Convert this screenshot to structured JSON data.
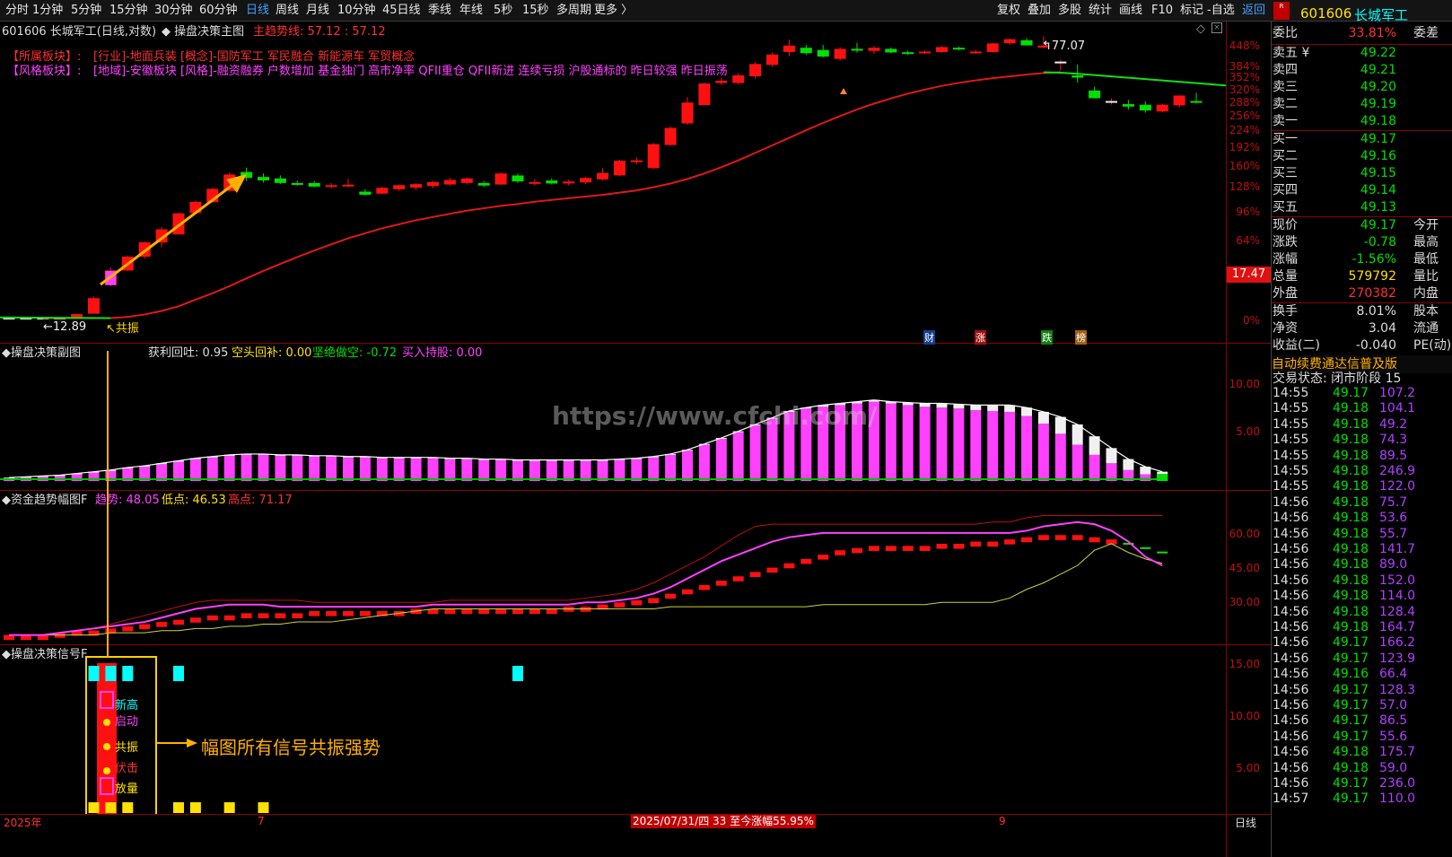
{
  "toolbar": {
    "periods": [
      "分时",
      "1分钟",
      "5分钟",
      "15分钟",
      "30分钟",
      "60分钟",
      "日线",
      "周线",
      "月线",
      "10分钟",
      "45日线",
      "季线",
      "年线",
      "5秒",
      "15秒",
      "多周期",
      "更多 〉"
    ],
    "active": "日线",
    "right": [
      "复权",
      "叠加",
      "多股",
      "统计",
      "画线",
      "F10",
      "标记",
      "-自选",
      "返回"
    ]
  },
  "main": {
    "title": "601606 长城军工(日线,对数)",
    "indicator_name": "操盘决策主图",
    "trend_label": "主趋势线: 57.12 : 57.12",
    "sector_label": "【所属板块】:",
    "sector_text": "[行业]-地面兵装 [概念]-国防军工 军民融合 新能源车 军贸概念",
    "style_label": "【风格板块】:",
    "style_text": "[地域]-安徽板块 [风格]-融资融券 户数增加 基金独门 高市净率 QFII重仓 QFII新进 连续亏损 沪股通标的 昨日较强 昨日振荡",
    "high_label": "77.07",
    "low_label": "12.89",
    "resonance_label": "共振",
    "current_price_tag": "17.47",
    "pct_ticks": [
      "448%",
      "384%",
      "352%",
      "320%",
      "288%",
      "256%",
      "224%",
      "192%",
      "160%",
      "128%",
      "96%",
      "64%",
      "0%"
    ],
    "event_tags": [
      "财",
      "涨",
      "跌",
      "榜"
    ]
  },
  "sub1": {
    "name": "操盘决策副图",
    "v1": "获利回吐: 0.95",
    "v2": "空头回补: 0.00",
    "v3": "坚绝做空: -0.72",
    "v4": "买入持股: 0.00",
    "ticks": [
      "10.00",
      "5.00"
    ],
    "watermark": "https://www.cfchi.com/",
    "values": [
      0.3,
      0.4,
      0.5,
      0.6,
      0.8,
      1.0,
      1.2,
      1.5,
      1.7,
      2.0,
      2.3,
      2.6,
      2.8,
      3.0,
      3.1,
      3.1,
      3.0,
      3.0,
      2.9,
      2.9,
      2.8,
      2.8,
      2.7,
      2.7,
      2.7,
      2.7,
      2.6,
      2.6,
      2.5,
      2.5,
      2.4,
      2.4,
      2.4,
      2.4,
      2.4,
      2.4,
      2.5,
      2.6,
      2.8,
      3.1,
      3.6,
      4.3,
      5.0,
      5.8,
      6.6,
      7.4,
      8.2,
      8.6,
      8.8,
      9.0,
      9.2,
      9.4,
      9.2,
      9.0,
      8.8,
      8.7,
      8.6,
      8.4,
      8.3,
      8.2,
      7.7,
      6.8,
      5.6,
      4.3,
      3.1,
      2.1,
      1.3,
      0.8,
      0.5
    ],
    "white_caps": [
      0.1,
      0.1,
      0.1,
      0.1,
      0.1,
      0.1,
      0.1,
      0.1,
      0.1,
      0.1,
      0.1,
      0.1,
      0.1,
      0.1,
      0.1,
      0.1,
      0.1,
      0.1,
      0.1,
      0.1,
      0.1,
      0.1,
      0.1,
      0.1,
      0.1,
      0.1,
      0.1,
      0.1,
      0.1,
      0.1,
      0.1,
      0.1,
      0.1,
      0.1,
      0.1,
      0.1,
      0.1,
      0.1,
      0.1,
      0.1,
      0.1,
      0.1,
      0.1,
      0.1,
      0.1,
      0.1,
      0.1,
      0.1,
      0.2,
      0.2,
      0.2,
      0.2,
      0.2,
      0.3,
      0.4,
      0.5,
      0.5,
      0.6,
      0.7,
      0.8,
      1.0,
      1.4,
      2.0,
      2.4,
      2.2,
      1.8,
      1.3,
      0.9,
      0.6
    ]
  },
  "sub2": {
    "name": "资金趋势幅图F",
    "v1": "趋势: 48.05",
    "v2": "低点: 46.53",
    "v3": "高点: 71.17",
    "ticks": [
      "60.00",
      "45.00",
      "30.00"
    ],
    "bars": [
      16,
      16,
      16,
      17,
      18,
      18,
      19,
      20,
      21,
      22,
      23,
      24,
      25,
      25,
      26,
      26,
      26,
      26,
      27,
      27,
      27,
      27,
      27,
      27,
      28,
      28,
      28,
      28,
      28,
      28,
      28,
      28,
      28,
      29,
      29,
      30,
      31,
      32,
      33,
      35,
      37,
      39,
      41,
      43,
      45,
      47,
      49,
      51,
      53,
      55,
      56,
      57,
      57,
      57,
      57,
      58,
      58,
      59,
      59,
      60,
      61,
      62,
      62,
      62,
      61,
      60,
      58,
      56,
      54
    ],
    "trend": [
      16,
      16,
      16,
      17,
      18,
      19,
      20,
      21,
      22,
      24,
      26,
      28,
      29,
      30,
      30,
      30,
      29,
      29,
      29,
      29,
      29,
      29,
      29,
      29,
      29,
      30,
      30,
      30,
      30,
      30,
      30,
      30,
      30,
      30,
      31,
      31,
      32,
      33,
      35,
      38,
      42,
      46,
      50,
      53,
      56,
      59,
      61,
      62,
      63,
      63,
      63,
      63,
      63,
      63,
      63,
      63,
      63,
      63,
      63,
      63,
      64,
      66,
      67,
      68,
      67,
      64,
      59,
      52,
      48
    ],
    "high": [
      16,
      16,
      16,
      17,
      18,
      19,
      21,
      23,
      25,
      27,
      29,
      31,
      32,
      32,
      32,
      32,
      32,
      32,
      31,
      31,
      31,
      31,
      31,
      31,
      31,
      31,
      32,
      32,
      32,
      32,
      32,
      32,
      32,
      32,
      33,
      34,
      35,
      37,
      40,
      44,
      48,
      52,
      57,
      62,
      66,
      67,
      67,
      67,
      67,
      67,
      67,
      67,
      67,
      67,
      67,
      67,
      67,
      67,
      68,
      68,
      70,
      71,
      71,
      71,
      71,
      71,
      71,
      71,
      71
    ],
    "low": [
      16,
      16,
      16,
      16,
      16,
      16,
      17,
      17,
      17,
      18,
      18,
      19,
      19,
      20,
      20,
      21,
      21,
      22,
      22,
      22,
      23,
      24,
      25,
      26,
      27,
      28,
      28,
      28,
      28,
      28,
      28,
      28,
      28,
      28,
      28,
      28,
      28,
      28,
      28,
      29,
      29,
      29,
      29,
      29,
      29,
      29,
      29,
      29,
      30,
      30,
      30,
      30,
      30,
      30,
      30,
      31,
      31,
      31,
      31,
      33,
      37,
      40,
      44,
      48,
      55,
      58,
      54,
      51,
      49
    ]
  },
  "sub3": {
    "name": "操盘决策信号F",
    "ticks": [
      "15.00",
      "10.00",
      "5.00"
    ],
    "legend": [
      "新高",
      "启动",
      "共振",
      "伏击",
      "放量"
    ],
    "annotation": "幅图所有信号共振强势"
  },
  "bottom": {
    "year": "2025年",
    "m7": "7",
    "m9": "9",
    "range_text": "2025/07/31/四 33 至今涨幅55.95%",
    "period": "日线"
  },
  "rightpanel": {
    "code": "601606",
    "name": "长城军工",
    "weibi_label": "委比",
    "weibi": "33.81%",
    "weicha_label": "委差",
    "asks": [
      {
        "l": "卖五 ¥",
        "p": "49.22"
      },
      {
        "l": "卖四",
        "p": "49.21"
      },
      {
        "l": "卖三",
        "p": "49.20"
      },
      {
        "l": "卖二",
        "p": "49.19"
      },
      {
        "l": "卖一",
        "p": "49.18"
      }
    ],
    "bids": [
      {
        "l": "买一",
        "p": "49.17"
      },
      {
        "l": "买二",
        "p": "49.16"
      },
      {
        "l": "买三",
        "p": "49.15"
      },
      {
        "l": "买四",
        "p": "49.14"
      },
      {
        "l": "买五",
        "p": "49.13"
      }
    ],
    "quote": [
      {
        "l": "现价",
        "v": "49.17",
        "x": "今开",
        "c": "green"
      },
      {
        "l": "涨跌",
        "v": "-0.78",
        "x": "最高",
        "c": "green"
      },
      {
        "l": "涨幅",
        "v": "-1.56%",
        "x": "最低",
        "c": "green"
      },
      {
        "l": "总量",
        "v": "579792",
        "x": "量比",
        "c": "yel"
      },
      {
        "l": "外盘",
        "v": "270382",
        "x": "内盘",
        "c": "red"
      },
      {
        "l": "换手",
        "v": "8.01%",
        "x": "股本",
        "c": "white"
      },
      {
        "l": "净资",
        "v": "3.04",
        "x": "流通",
        "c": "white"
      },
      {
        "l": "收益(二)",
        "v": "-0.040",
        "x": "PE(动)",
        "c": "white"
      }
    ],
    "banner": "自动续费通达信普及版",
    "status": "交易状态: 闭市阶段 15",
    "ticks": [
      {
        "t": "14:55",
        "p": "49.17",
        "v": "107.2",
        "c": "green"
      },
      {
        "t": "14:55",
        "p": "49.18",
        "v": "104.1",
        "c": "green"
      },
      {
        "t": "14:55",
        "p": "49.18",
        "v": "49.2",
        "c": "green"
      },
      {
        "t": "14:55",
        "p": "49.18",
        "v": "74.3",
        "c": "green"
      },
      {
        "t": "14:55",
        "p": "49.18",
        "v": "89.5",
        "c": "green"
      },
      {
        "t": "14:55",
        "p": "49.18",
        "v": "246.9",
        "c": "green"
      },
      {
        "t": "14:55",
        "p": "49.18",
        "v": "122.0",
        "c": "green"
      },
      {
        "t": "14:56",
        "p": "49.18",
        "v": "75.7",
        "c": "green"
      },
      {
        "t": "14:56",
        "p": "49.18",
        "v": "53.6",
        "c": "green"
      },
      {
        "t": "14:56",
        "p": "49.18",
        "v": "55.7",
        "c": "green"
      },
      {
        "t": "14:56",
        "p": "49.18",
        "v": "141.7",
        "c": "green"
      },
      {
        "t": "14:56",
        "p": "49.18",
        "v": "89.0",
        "c": "green"
      },
      {
        "t": "14:56",
        "p": "49.18",
        "v": "152.0",
        "c": "green"
      },
      {
        "t": "14:56",
        "p": "49.18",
        "v": "114.0",
        "c": "green"
      },
      {
        "t": "14:56",
        "p": "49.18",
        "v": "128.4",
        "c": "green"
      },
      {
        "t": "14:56",
        "p": "49.18",
        "v": "164.7",
        "c": "green"
      },
      {
        "t": "14:56",
        "p": "49.17",
        "v": "166.2",
        "c": "green"
      },
      {
        "t": "14:56",
        "p": "49.17",
        "v": "123.9",
        "c": "green"
      },
      {
        "t": "14:56",
        "p": "49.16",
        "v": "66.4",
        "c": "green"
      },
      {
        "t": "14:56",
        "p": "49.17",
        "v": "128.3",
        "c": "green"
      },
      {
        "t": "14:56",
        "p": "49.17",
        "v": "57.0",
        "c": "green"
      },
      {
        "t": "14:56",
        "p": "49.17",
        "v": "86.5",
        "c": "green"
      },
      {
        "t": "14:56",
        "p": "49.17",
        "v": "55.6",
        "c": "green"
      },
      {
        "t": "14:56",
        "p": "49.18",
        "v": "175.7",
        "c": "green"
      },
      {
        "t": "14:56",
        "p": "49.18",
        "v": "59.0",
        "c": "green"
      },
      {
        "t": "14:56",
        "p": "49.17",
        "v": "236.0",
        "c": "green"
      },
      {
        "t": "14:57",
        "p": "49.17",
        "v": "110.0",
        "c": "green"
      }
    ]
  },
  "candles": [
    {
      "o": 12.9,
      "h": 13.0,
      "l": 12.8,
      "c": 12.9
    },
    {
      "o": 12.9,
      "h": 13.0,
      "l": 12.8,
      "c": 12.9
    },
    {
      "o": 12.9,
      "h": 13.0,
      "l": 12.85,
      "c": 12.9
    },
    {
      "o": 12.9,
      "h": 13.0,
      "l": 12.85,
      "c": 12.9
    },
    {
      "o": 12.9,
      "h": 13.2,
      "l": 12.85,
      "c": 13.2
    },
    {
      "o": 13.3,
      "h": 14.8,
      "l": 13.3,
      "c": 14.6
    },
    {
      "o": 16.0,
      "h": 17.8,
      "l": 15.8,
      "c": 17.4
    },
    {
      "o": 17.5,
      "h": 19.2,
      "l": 17.4,
      "c": 19.0
    },
    {
      "o": 19.1,
      "h": 21.0,
      "l": 18.8,
      "c": 20.8
    },
    {
      "o": 20.9,
      "h": 23.0,
      "l": 20.2,
      "c": 22.6
    },
    {
      "o": 22.0,
      "h": 25.2,
      "l": 22.0,
      "c": 25.0
    },
    {
      "o": 25.2,
      "h": 27.2,
      "l": 25.0,
      "c": 26.9
    },
    {
      "o": 27.0,
      "h": 29.5,
      "l": 26.8,
      "c": 29.2
    },
    {
      "o": 29.0,
      "h": 32.5,
      "l": 28.8,
      "c": 32.0
    },
    {
      "o": 32.5,
      "h": 33.5,
      "l": 30.8,
      "c": 31.5
    },
    {
      "o": 31.5,
      "h": 32.3,
      "l": 30.5,
      "c": 31.0
    },
    {
      "o": 31.2,
      "h": 31.9,
      "l": 30.2,
      "c": 30.5
    },
    {
      "o": 30.3,
      "h": 30.9,
      "l": 29.9,
      "c": 30.2
    },
    {
      "o": 30.3,
      "h": 30.8,
      "l": 29.6,
      "c": 29.8
    },
    {
      "o": 29.8,
      "h": 30.4,
      "l": 29.4,
      "c": 29.9
    },
    {
      "o": 29.9,
      "h": 31.2,
      "l": 29.5,
      "c": 30.0
    },
    {
      "o": 28.7,
      "h": 29.2,
      "l": 28.1,
      "c": 28.3
    },
    {
      "o": 28.5,
      "h": 29.7,
      "l": 28.3,
      "c": 29.4
    },
    {
      "o": 29.3,
      "h": 30.1,
      "l": 28.9,
      "c": 29.9
    },
    {
      "o": 29.6,
      "h": 30.4,
      "l": 29.1,
      "c": 30.1
    },
    {
      "o": 29.9,
      "h": 30.8,
      "l": 29.4,
      "c": 30.5
    },
    {
      "o": 30.2,
      "h": 31.4,
      "l": 29.9,
      "c": 30.9
    },
    {
      "o": 30.5,
      "h": 31.5,
      "l": 30.1,
      "c": 31.2
    },
    {
      "o": 30.3,
      "h": 30.8,
      "l": 29.6,
      "c": 30.0
    },
    {
      "o": 30.2,
      "h": 32.5,
      "l": 30.0,
      "c": 32.2
    },
    {
      "o": 31.8,
      "h": 32.3,
      "l": 30.4,
      "c": 30.8
    },
    {
      "o": 30.4,
      "h": 31.2,
      "l": 29.9,
      "c": 30.5
    },
    {
      "o": 30.8,
      "h": 31.3,
      "l": 30.1,
      "c": 30.4
    },
    {
      "o": 30.4,
      "h": 31.1,
      "l": 29.9,
      "c": 30.6
    },
    {
      "o": 30.6,
      "h": 31.6,
      "l": 30.2,
      "c": 31.3
    },
    {
      "o": 31.2,
      "h": 33.4,
      "l": 30.9,
      "c": 32.3
    },
    {
      "o": 32.0,
      "h": 35.2,
      "l": 31.8,
      "c": 34.9
    },
    {
      "o": 34.8,
      "h": 35.8,
      "l": 34.2,
      "c": 35.0
    },
    {
      "o": 33.5,
      "h": 39.2,
      "l": 33.2,
      "c": 38.8
    },
    {
      "o": 38.8,
      "h": 43.5,
      "l": 38.5,
      "c": 43.0
    },
    {
      "o": 44.5,
      "h": 52.5,
      "l": 44.0,
      "c": 50.5
    },
    {
      "o": 50.0,
      "h": 57.5,
      "l": 49.8,
      "c": 57.0
    },
    {
      "o": 57.5,
      "h": 59.2,
      "l": 56.5,
      "c": 58.0
    },
    {
      "o": 57.5,
      "h": 61.0,
      "l": 56.8,
      "c": 60.0
    },
    {
      "o": 60.0,
      "h": 65.5,
      "l": 59.0,
      "c": 64.5
    },
    {
      "o": 64.5,
      "h": 69.5,
      "l": 63.5,
      "c": 68.5
    },
    {
      "o": 70.0,
      "h": 75.5,
      "l": 68.0,
      "c": 72.5
    },
    {
      "o": 71.5,
      "h": 73.0,
      "l": 68.5,
      "c": 69.5
    },
    {
      "o": 70.5,
      "h": 73.0,
      "l": 67.5,
      "c": 68.0
    },
    {
      "o": 67.0,
      "h": 72.0,
      "l": 66.0,
      "c": 71.0
    },
    {
      "o": 71.0,
      "h": 74.0,
      "l": 69.5,
      "c": 70.8
    },
    {
      "o": 70.5,
      "h": 72.5,
      "l": 69.0,
      "c": 71.5
    },
    {
      "o": 71.0,
      "h": 71.8,
      "l": 69.2,
      "c": 69.8
    },
    {
      "o": 69.5,
      "h": 70.5,
      "l": 68.5,
      "c": 69.2
    },
    {
      "o": 69.5,
      "h": 70.5,
      "l": 69.0,
      "c": 69.8
    },
    {
      "o": 70.0,
      "h": 72.5,
      "l": 69.5,
      "c": 71.8
    },
    {
      "o": 71.5,
      "h": 72.2,
      "l": 70.5,
      "c": 71.2
    },
    {
      "o": 69.5,
      "h": 70.8,
      "l": 69.0,
      "c": 69.8
    },
    {
      "o": 70.0,
      "h": 74.0,
      "l": 69.5,
      "c": 73.5
    },
    {
      "o": 74.0,
      "h": 76.0,
      "l": 73.0,
      "c": 75.5
    },
    {
      "o": 75.0,
      "h": 76.2,
      "l": 72.8,
      "c": 73.0
    },
    {
      "o": 72.0,
      "h": 77.1,
      "l": 71.5,
      "c": 72.5
    },
    {
      "o": 65.5,
      "h": 66.5,
      "l": 62.0,
      "c": 65.5
    },
    {
      "o": 60.0,
      "h": 64.5,
      "l": 57.5,
      "c": 59.5
    },
    {
      "o": 54.5,
      "h": 56.0,
      "l": 52.0,
      "c": 52.2
    },
    {
      "o": 51.0,
      "h": 52.0,
      "l": 50.0,
      "c": 51.0
    },
    {
      "o": 50.0,
      "h": 51.5,
      "l": 48.5,
      "c": 49.5
    },
    {
      "o": 49.8,
      "h": 51.0,
      "l": 47.5,
      "c": 48.3
    },
    {
      "o": 48.0,
      "h": 50.2,
      "l": 47.6,
      "c": 49.8
    },
    {
      "o": 49.9,
      "h": 53.0,
      "l": 49.1,
      "c": 52.8
    },
    {
      "o": 51.0,
      "h": 53.9,
      "l": 50.4,
      "c": 50.9
    }
  ],
  "ma": {
    "red": [
      12.9,
      12.9,
      12.9,
      12.9,
      12.9,
      13.0,
      13.2,
      13.5,
      13.9,
      14.5,
      15.1,
      15.8,
      16.6,
      17.4,
      18.2,
      19.0,
      19.8,
      20.6,
      21.4,
      22.1,
      22.8,
      23.4,
      24.0,
      24.5,
      25.0,
      25.5,
      25.9,
      26.3,
      26.6,
      27.0,
      27.3,
      27.6,
      27.9,
      28.2,
      28.6,
      29.0,
      29.6,
      30.3,
      31.2,
      32.3,
      33.6,
      35.1,
      36.8,
      38.6,
      40.5,
      42.5,
      44.5,
      46.5,
      48.5,
      50.3,
      52.0,
      53.6,
      55.0,
      56.3,
      57.4,
      58.3,
      59.1,
      59.8,
      60.5,
      61.1,
      61.4
    ],
    "green": [
      61.4,
      61.2,
      60.8,
      60.3,
      59.8,
      59.3,
      58.8,
      58.3,
      57.8,
      57.3,
      56.8,
      56.3
    ]
  },
  "sub3_data": {
    "cyan": [
      5,
      6,
      7,
      10,
      30
    ],
    "yellow": [
      5,
      6,
      7,
      10,
      11,
      13,
      15
    ]
  },
  "colors": {
    "up": "#ff1010",
    "down": "#00e000",
    "ma": "#e01818",
    "ma2": "#10e010",
    "magenta": "#ff40ff",
    "cyan": "#00ffff",
    "yellow": "#ffe000",
    "annot": "#ffb000"
  }
}
